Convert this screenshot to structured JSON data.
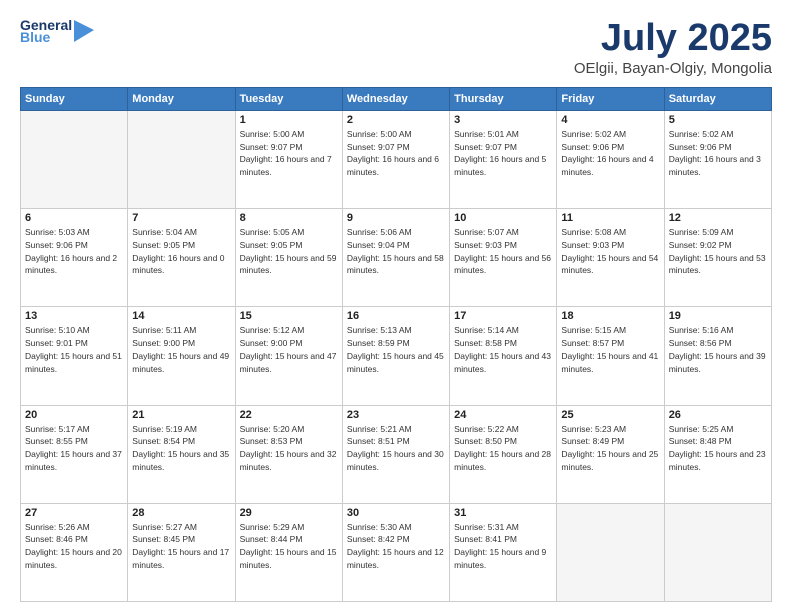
{
  "header": {
    "logo_line1": "General",
    "logo_line2": "Blue",
    "title": "July 2025",
    "subtitle": "OElgii, Bayan-Olgiy, Mongolia"
  },
  "weekdays": [
    "Sunday",
    "Monday",
    "Tuesday",
    "Wednesday",
    "Thursday",
    "Friday",
    "Saturday"
  ],
  "weeks": [
    [
      {
        "day": "",
        "empty": true
      },
      {
        "day": "",
        "empty": true
      },
      {
        "day": "1",
        "sunrise": "Sunrise: 5:00 AM",
        "sunset": "Sunset: 9:07 PM",
        "daylight": "Daylight: 16 hours and 7 minutes."
      },
      {
        "day": "2",
        "sunrise": "Sunrise: 5:00 AM",
        "sunset": "Sunset: 9:07 PM",
        "daylight": "Daylight: 16 hours and 6 minutes."
      },
      {
        "day": "3",
        "sunrise": "Sunrise: 5:01 AM",
        "sunset": "Sunset: 9:07 PM",
        "daylight": "Daylight: 16 hours and 5 minutes."
      },
      {
        "day": "4",
        "sunrise": "Sunrise: 5:02 AM",
        "sunset": "Sunset: 9:06 PM",
        "daylight": "Daylight: 16 hours and 4 minutes."
      },
      {
        "day": "5",
        "sunrise": "Sunrise: 5:02 AM",
        "sunset": "Sunset: 9:06 PM",
        "daylight": "Daylight: 16 hours and 3 minutes."
      }
    ],
    [
      {
        "day": "6",
        "sunrise": "Sunrise: 5:03 AM",
        "sunset": "Sunset: 9:06 PM",
        "daylight": "Daylight: 16 hours and 2 minutes."
      },
      {
        "day": "7",
        "sunrise": "Sunrise: 5:04 AM",
        "sunset": "Sunset: 9:05 PM",
        "daylight": "Daylight: 16 hours and 0 minutes."
      },
      {
        "day": "8",
        "sunrise": "Sunrise: 5:05 AM",
        "sunset": "Sunset: 9:05 PM",
        "daylight": "Daylight: 15 hours and 59 minutes."
      },
      {
        "day": "9",
        "sunrise": "Sunrise: 5:06 AM",
        "sunset": "Sunset: 9:04 PM",
        "daylight": "Daylight: 15 hours and 58 minutes."
      },
      {
        "day": "10",
        "sunrise": "Sunrise: 5:07 AM",
        "sunset": "Sunset: 9:03 PM",
        "daylight": "Daylight: 15 hours and 56 minutes."
      },
      {
        "day": "11",
        "sunrise": "Sunrise: 5:08 AM",
        "sunset": "Sunset: 9:03 PM",
        "daylight": "Daylight: 15 hours and 54 minutes."
      },
      {
        "day": "12",
        "sunrise": "Sunrise: 5:09 AM",
        "sunset": "Sunset: 9:02 PM",
        "daylight": "Daylight: 15 hours and 53 minutes."
      }
    ],
    [
      {
        "day": "13",
        "sunrise": "Sunrise: 5:10 AM",
        "sunset": "Sunset: 9:01 PM",
        "daylight": "Daylight: 15 hours and 51 minutes."
      },
      {
        "day": "14",
        "sunrise": "Sunrise: 5:11 AM",
        "sunset": "Sunset: 9:00 PM",
        "daylight": "Daylight: 15 hours and 49 minutes."
      },
      {
        "day": "15",
        "sunrise": "Sunrise: 5:12 AM",
        "sunset": "Sunset: 9:00 PM",
        "daylight": "Daylight: 15 hours and 47 minutes."
      },
      {
        "day": "16",
        "sunrise": "Sunrise: 5:13 AM",
        "sunset": "Sunset: 8:59 PM",
        "daylight": "Daylight: 15 hours and 45 minutes."
      },
      {
        "day": "17",
        "sunrise": "Sunrise: 5:14 AM",
        "sunset": "Sunset: 8:58 PM",
        "daylight": "Daylight: 15 hours and 43 minutes."
      },
      {
        "day": "18",
        "sunrise": "Sunrise: 5:15 AM",
        "sunset": "Sunset: 8:57 PM",
        "daylight": "Daylight: 15 hours and 41 minutes."
      },
      {
        "day": "19",
        "sunrise": "Sunrise: 5:16 AM",
        "sunset": "Sunset: 8:56 PM",
        "daylight": "Daylight: 15 hours and 39 minutes."
      }
    ],
    [
      {
        "day": "20",
        "sunrise": "Sunrise: 5:17 AM",
        "sunset": "Sunset: 8:55 PM",
        "daylight": "Daylight: 15 hours and 37 minutes."
      },
      {
        "day": "21",
        "sunrise": "Sunrise: 5:19 AM",
        "sunset": "Sunset: 8:54 PM",
        "daylight": "Daylight: 15 hours and 35 minutes."
      },
      {
        "day": "22",
        "sunrise": "Sunrise: 5:20 AM",
        "sunset": "Sunset: 8:53 PM",
        "daylight": "Daylight: 15 hours and 32 minutes."
      },
      {
        "day": "23",
        "sunrise": "Sunrise: 5:21 AM",
        "sunset": "Sunset: 8:51 PM",
        "daylight": "Daylight: 15 hours and 30 minutes."
      },
      {
        "day": "24",
        "sunrise": "Sunrise: 5:22 AM",
        "sunset": "Sunset: 8:50 PM",
        "daylight": "Daylight: 15 hours and 28 minutes."
      },
      {
        "day": "25",
        "sunrise": "Sunrise: 5:23 AM",
        "sunset": "Sunset: 8:49 PM",
        "daylight": "Daylight: 15 hours and 25 minutes."
      },
      {
        "day": "26",
        "sunrise": "Sunrise: 5:25 AM",
        "sunset": "Sunset: 8:48 PM",
        "daylight": "Daylight: 15 hours and 23 minutes."
      }
    ],
    [
      {
        "day": "27",
        "sunrise": "Sunrise: 5:26 AM",
        "sunset": "Sunset: 8:46 PM",
        "daylight": "Daylight: 15 hours and 20 minutes."
      },
      {
        "day": "28",
        "sunrise": "Sunrise: 5:27 AM",
        "sunset": "Sunset: 8:45 PM",
        "daylight": "Daylight: 15 hours and 17 minutes."
      },
      {
        "day": "29",
        "sunrise": "Sunrise: 5:29 AM",
        "sunset": "Sunset: 8:44 PM",
        "daylight": "Daylight: 15 hours and 15 minutes."
      },
      {
        "day": "30",
        "sunrise": "Sunrise: 5:30 AM",
        "sunset": "Sunset: 8:42 PM",
        "daylight": "Daylight: 15 hours and 12 minutes."
      },
      {
        "day": "31",
        "sunrise": "Sunrise: 5:31 AM",
        "sunset": "Sunset: 8:41 PM",
        "daylight": "Daylight: 15 hours and 9 minutes."
      },
      {
        "day": "",
        "empty": true
      },
      {
        "day": "",
        "empty": true
      }
    ]
  ]
}
